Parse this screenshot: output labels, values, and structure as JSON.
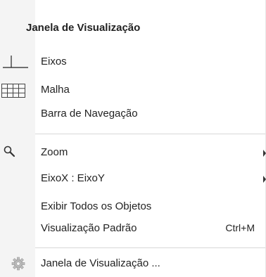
{
  "menu": {
    "header": "Janela de Visualização",
    "items": [
      {
        "label": "Eixos",
        "icon": "axes-icon"
      },
      {
        "label": "Malha",
        "icon": "grid-icon"
      },
      {
        "label": "Barra de Navegação"
      },
      {
        "label": "Zoom",
        "icon": "zoom-icon",
        "submenu": true
      },
      {
        "label": "EixoX : EixoY",
        "submenu": true
      },
      {
        "label": "Exibir Todos os Objetos"
      },
      {
        "label": "Visualização Padrão",
        "shortcut": "Ctrl+M"
      },
      {
        "label": "Janela de Visualização ...",
        "icon": "gear-icon"
      }
    ]
  }
}
